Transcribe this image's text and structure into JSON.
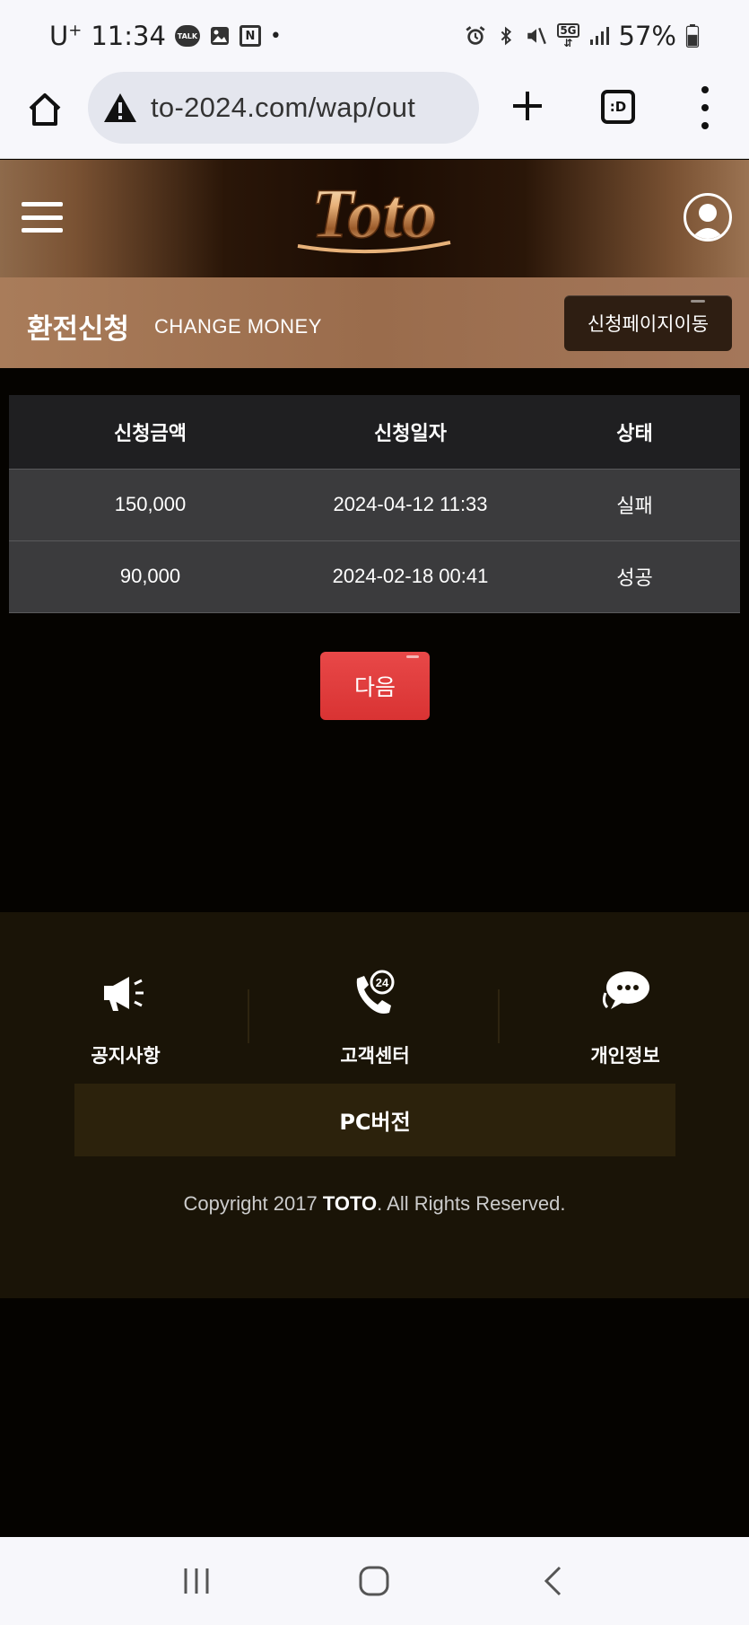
{
  "status_bar": {
    "carrier": "U",
    "carrier_sup": "+",
    "time": "11:34",
    "talk_badge": "TALK",
    "n_badge": "N",
    "network": "5G",
    "battery": "57%"
  },
  "browser": {
    "url": "to-2024.com/wap/out",
    "tab_badge": ":D"
  },
  "header": {
    "logo_text": "Toto"
  },
  "title_band": {
    "title_ko": "환전신청",
    "title_en": "CHANGE MONEY",
    "move_button": "신청페이지이동"
  },
  "table": {
    "headers": [
      "신청금액",
      "신청일자",
      "상태"
    ],
    "rows": [
      {
        "amount": "150,000",
        "date": "2024-04-12 11:33",
        "status": "실패"
      },
      {
        "amount": "90,000",
        "date": "2024-02-18 00:41",
        "status": "성공"
      }
    ]
  },
  "next_button": "다음",
  "footer": {
    "nav": [
      {
        "label": "공지사항",
        "icon": "megaphone-icon"
      },
      {
        "label": "고객센터",
        "icon": "phone-24-icon"
      },
      {
        "label": "개인정보",
        "icon": "chat-bubbles-icon"
      }
    ],
    "pc_button": "PC버전",
    "copyright_prefix": "Copyright 2017 ",
    "copyright_brand": "TOTO",
    "copyright_suffix": ". All Rights Reserved."
  },
  "colors": {
    "accent_red": "#e03a3a",
    "band_brown": "#a37657",
    "footer_bg": "#1a1407"
  }
}
